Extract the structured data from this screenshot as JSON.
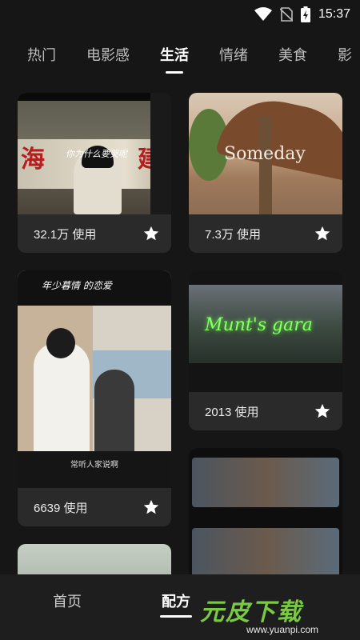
{
  "status_bar": {
    "time": "15:37"
  },
  "tabs": [
    {
      "label": "热门",
      "active": false
    },
    {
      "label": "电影感",
      "active": false
    },
    {
      "label": "生活",
      "active": true
    },
    {
      "label": "情绪",
      "active": false
    },
    {
      "label": "美食",
      "active": false
    },
    {
      "label": "影",
      "active": false
    }
  ],
  "cards": [
    {
      "usage": "32.1万 使用",
      "overlay": "你为什么要哭呢"
    },
    {
      "usage": "7.3万 使用",
      "overlay": "Someday"
    },
    {
      "usage": "6639 使用",
      "overlay": "年少暮情 的恋爱",
      "caption": "常听人家说啊"
    },
    {
      "usage": "2013 使用",
      "overlay": "Munt's gara"
    },
    {
      "usage": ""
    },
    {
      "usage": ""
    }
  ],
  "bottom_nav": {
    "home_label": "首页",
    "recipe_label": "配方"
  },
  "watermark": {
    "brand": "元皮下载",
    "url": "www.yuanpi.com"
  },
  "colors": {
    "background": "#161616",
    "card": "#2a2a2a",
    "active_text": "#ffffff",
    "inactive_text": "#bdbdbd",
    "watermark_green": "#7ac943"
  }
}
